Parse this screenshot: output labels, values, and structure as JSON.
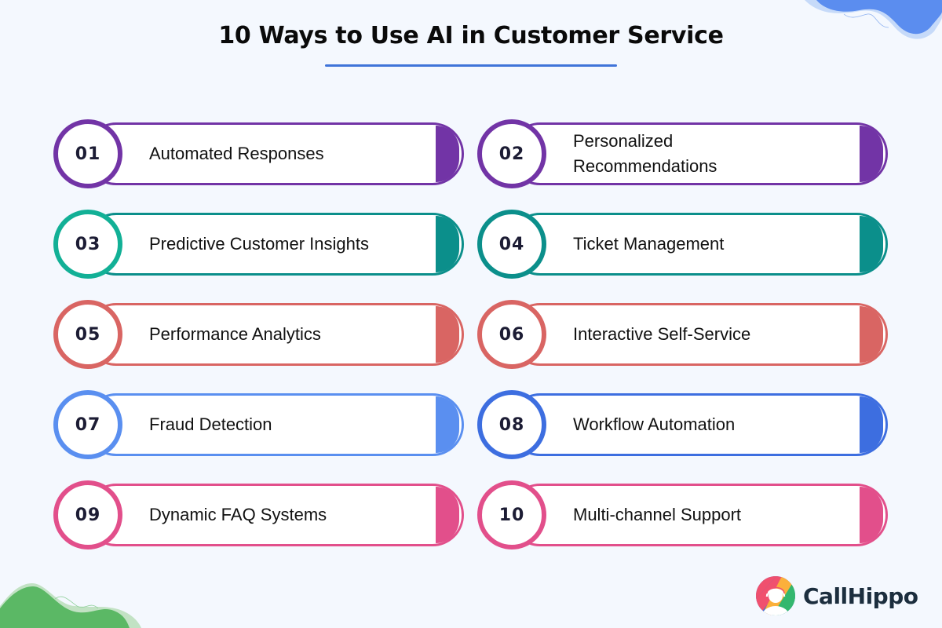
{
  "header": {
    "title": "10 Ways to Use AI in Customer Service"
  },
  "items": [
    {
      "number": "01",
      "label": "Automated Responses",
      "color": "#7234a6"
    },
    {
      "number": "02",
      "label": "Personalized Recommendations",
      "color": "#7234a6"
    },
    {
      "number": "03",
      "label": "Predictive Customer Insights",
      "color": "#0b8f8b",
      "circle_color": "#12b096"
    },
    {
      "number": "04",
      "label": "Ticket Management",
      "color": "#0b8f8b"
    },
    {
      "number": "05",
      "label": "Performance Analytics",
      "color": "#d96563"
    },
    {
      "number": "06",
      "label": "Interactive Self-Service",
      "color": "#d96563"
    },
    {
      "number": "07",
      "label": "Fraud Detection",
      "color": "#5a8ff0"
    },
    {
      "number": "08",
      "label": "Workflow Automation",
      "color": "#3d6ee0"
    },
    {
      "number": "09",
      "label": "Dynamic FAQ Systems",
      "color": "#e24f8b"
    },
    {
      "number": "10",
      "label": "Multi-channel Support",
      "color": "#e24f8b"
    }
  ],
  "brand": {
    "name": "CallHippo",
    "logo_icon": "callhippo-headset-logo-icon"
  },
  "colors": {
    "background": "#f4f8fe",
    "title_underline": "#3f74d9",
    "wave_top": "#5b8def",
    "wave_bottom": "#5bb865"
  }
}
